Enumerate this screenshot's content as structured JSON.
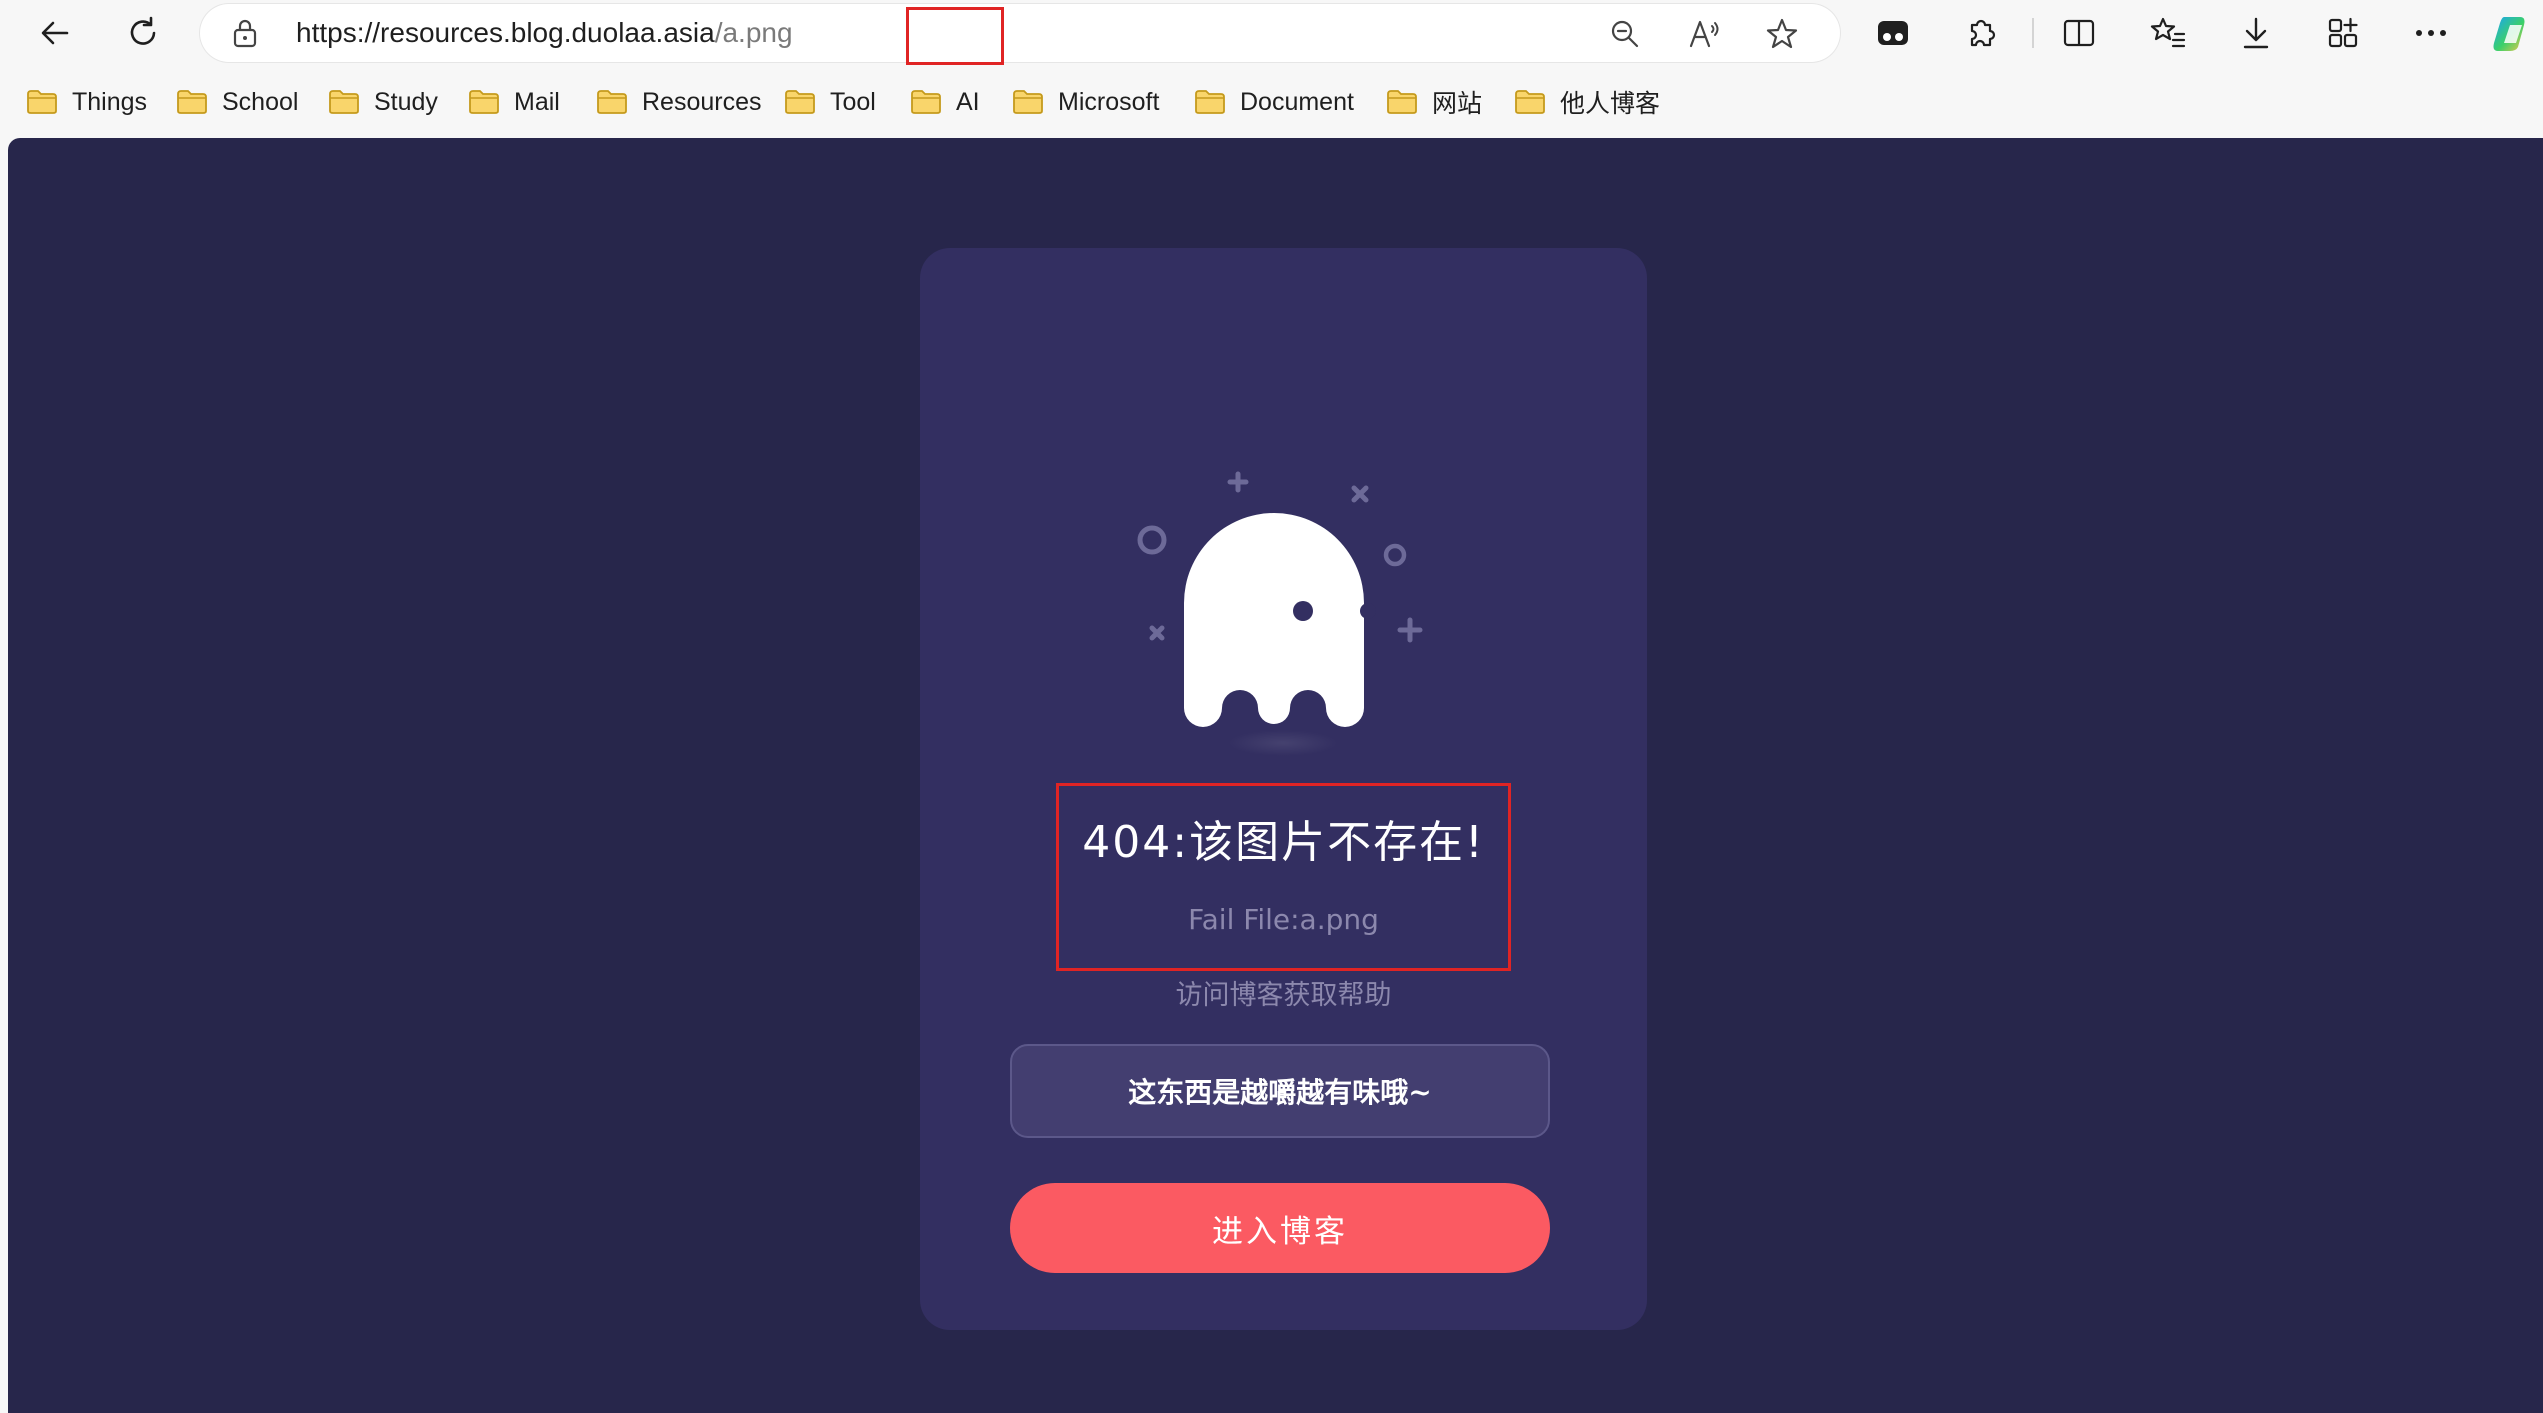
{
  "browser": {
    "url_host": "https://resources.blog.duolaa.asia",
    "url_path": "/a.png",
    "nav": {
      "back_icon": "back-arrow-icon",
      "refresh_icon": "refresh-icon"
    }
  },
  "bookmarks": [
    {
      "label": "Things"
    },
    {
      "label": "School"
    },
    {
      "label": "Study"
    },
    {
      "label": "Mail"
    },
    {
      "label": "Resources"
    },
    {
      "label": "Tool"
    },
    {
      "label": "AI"
    },
    {
      "label": "Microsoft"
    },
    {
      "label": "Document"
    },
    {
      "label": "网站"
    },
    {
      "label": "他人博客"
    }
  ],
  "page": {
    "title": "404:该图片不存在!",
    "subtitle": "Fail File:a.png",
    "help_link": "访问博客获取帮助",
    "quote": "这东西是越嚼越有味哦~",
    "enter_button": "进入博客"
  },
  "colors": {
    "page_bg": "#27264b",
    "card_bg": "#332f61",
    "button_accent": "#fb5a62",
    "highlight_box": "#e02424"
  }
}
